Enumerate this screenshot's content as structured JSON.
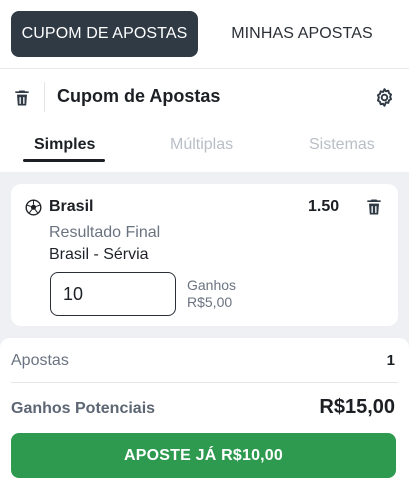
{
  "top_tabs": {
    "betslip": "CUPOM DE APOSTAS",
    "my_bets": "MINHAS APOSTAS"
  },
  "header": {
    "title": "Cupom de Apostas",
    "icons": [
      "trash-icon",
      "gear-icon"
    ]
  },
  "sub_tabs": {
    "single": "Simples",
    "multiple": "Múltiplas",
    "systems": "Sistemas"
  },
  "selection": {
    "team": "Brasil",
    "odds": "1.50",
    "market": "Resultado Final",
    "event": "Brasil - Sérvia",
    "stake": "10",
    "winnings_label": "Ganhos",
    "winnings_value": "R$5,00",
    "icons": [
      "football-icon",
      "trash-icon"
    ]
  },
  "summary": {
    "bets_label": "Apostas",
    "bets_count": "1",
    "potential_label": "Ganhos Potenciais",
    "potential_value": "R$15,00",
    "place_button": "APOSTE JÁ R$10,00"
  },
  "colors": {
    "active_tab_bg": "#2f3a45",
    "place_button_bg": "#2e9a4f",
    "disabled_text": "#b9bec6",
    "muted_text": "#6a7380"
  }
}
